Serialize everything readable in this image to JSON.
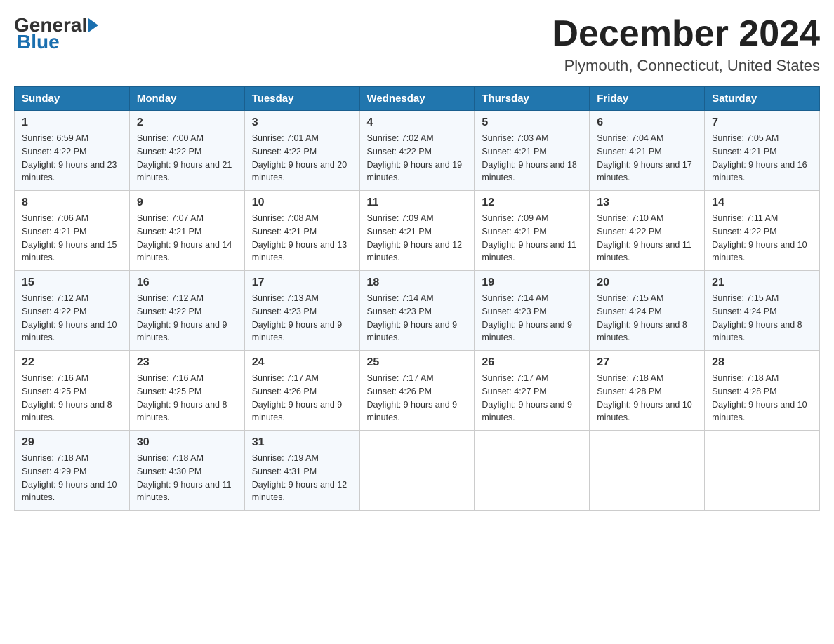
{
  "header": {
    "logo_general": "General",
    "logo_blue": "Blue",
    "month_title": "December 2024",
    "location": "Plymouth, Connecticut, United States"
  },
  "weekdays": [
    "Sunday",
    "Monday",
    "Tuesday",
    "Wednesday",
    "Thursday",
    "Friday",
    "Saturday"
  ],
  "weeks": [
    [
      {
        "day": "1",
        "sunrise": "6:59 AM",
        "sunset": "4:22 PM",
        "daylight": "9 hours and 23 minutes."
      },
      {
        "day": "2",
        "sunrise": "7:00 AM",
        "sunset": "4:22 PM",
        "daylight": "9 hours and 21 minutes."
      },
      {
        "day": "3",
        "sunrise": "7:01 AM",
        "sunset": "4:22 PM",
        "daylight": "9 hours and 20 minutes."
      },
      {
        "day": "4",
        "sunrise": "7:02 AM",
        "sunset": "4:22 PM",
        "daylight": "9 hours and 19 minutes."
      },
      {
        "day": "5",
        "sunrise": "7:03 AM",
        "sunset": "4:21 PM",
        "daylight": "9 hours and 18 minutes."
      },
      {
        "day": "6",
        "sunrise": "7:04 AM",
        "sunset": "4:21 PM",
        "daylight": "9 hours and 17 minutes."
      },
      {
        "day": "7",
        "sunrise": "7:05 AM",
        "sunset": "4:21 PM",
        "daylight": "9 hours and 16 minutes."
      }
    ],
    [
      {
        "day": "8",
        "sunrise": "7:06 AM",
        "sunset": "4:21 PM",
        "daylight": "9 hours and 15 minutes."
      },
      {
        "day": "9",
        "sunrise": "7:07 AM",
        "sunset": "4:21 PM",
        "daylight": "9 hours and 14 minutes."
      },
      {
        "day": "10",
        "sunrise": "7:08 AM",
        "sunset": "4:21 PM",
        "daylight": "9 hours and 13 minutes."
      },
      {
        "day": "11",
        "sunrise": "7:09 AM",
        "sunset": "4:21 PM",
        "daylight": "9 hours and 12 minutes."
      },
      {
        "day": "12",
        "sunrise": "7:09 AM",
        "sunset": "4:21 PM",
        "daylight": "9 hours and 11 minutes."
      },
      {
        "day": "13",
        "sunrise": "7:10 AM",
        "sunset": "4:22 PM",
        "daylight": "9 hours and 11 minutes."
      },
      {
        "day": "14",
        "sunrise": "7:11 AM",
        "sunset": "4:22 PM",
        "daylight": "9 hours and 10 minutes."
      }
    ],
    [
      {
        "day": "15",
        "sunrise": "7:12 AM",
        "sunset": "4:22 PM",
        "daylight": "9 hours and 10 minutes."
      },
      {
        "day": "16",
        "sunrise": "7:12 AM",
        "sunset": "4:22 PM",
        "daylight": "9 hours and 9 minutes."
      },
      {
        "day": "17",
        "sunrise": "7:13 AM",
        "sunset": "4:23 PM",
        "daylight": "9 hours and 9 minutes."
      },
      {
        "day": "18",
        "sunrise": "7:14 AM",
        "sunset": "4:23 PM",
        "daylight": "9 hours and 9 minutes."
      },
      {
        "day": "19",
        "sunrise": "7:14 AM",
        "sunset": "4:23 PM",
        "daylight": "9 hours and 9 minutes."
      },
      {
        "day": "20",
        "sunrise": "7:15 AM",
        "sunset": "4:24 PM",
        "daylight": "9 hours and 8 minutes."
      },
      {
        "day": "21",
        "sunrise": "7:15 AM",
        "sunset": "4:24 PM",
        "daylight": "9 hours and 8 minutes."
      }
    ],
    [
      {
        "day": "22",
        "sunrise": "7:16 AM",
        "sunset": "4:25 PM",
        "daylight": "9 hours and 8 minutes."
      },
      {
        "day": "23",
        "sunrise": "7:16 AM",
        "sunset": "4:25 PM",
        "daylight": "9 hours and 8 minutes."
      },
      {
        "day": "24",
        "sunrise": "7:17 AM",
        "sunset": "4:26 PM",
        "daylight": "9 hours and 9 minutes."
      },
      {
        "day": "25",
        "sunrise": "7:17 AM",
        "sunset": "4:26 PM",
        "daylight": "9 hours and 9 minutes."
      },
      {
        "day": "26",
        "sunrise": "7:17 AM",
        "sunset": "4:27 PM",
        "daylight": "9 hours and 9 minutes."
      },
      {
        "day": "27",
        "sunrise": "7:18 AM",
        "sunset": "4:28 PM",
        "daylight": "9 hours and 10 minutes."
      },
      {
        "day": "28",
        "sunrise": "7:18 AM",
        "sunset": "4:28 PM",
        "daylight": "9 hours and 10 minutes."
      }
    ],
    [
      {
        "day": "29",
        "sunrise": "7:18 AM",
        "sunset": "4:29 PM",
        "daylight": "9 hours and 10 minutes."
      },
      {
        "day": "30",
        "sunrise": "7:18 AM",
        "sunset": "4:30 PM",
        "daylight": "9 hours and 11 minutes."
      },
      {
        "day": "31",
        "sunrise": "7:19 AM",
        "sunset": "4:31 PM",
        "daylight": "9 hours and 12 minutes."
      },
      null,
      null,
      null,
      null
    ]
  ]
}
